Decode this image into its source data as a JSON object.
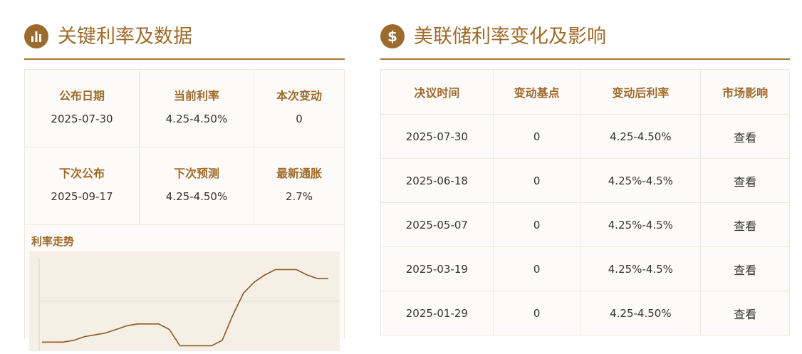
{
  "left": {
    "title": "关键利率及数据",
    "icon": "bar-chart-icon",
    "stats": [
      {
        "label": "公布日期",
        "value": "2025-07-30"
      },
      {
        "label": "当前利率",
        "value": "4.25-4.50%"
      },
      {
        "label": "本次变动",
        "value": "0"
      },
      {
        "label": "下次公布",
        "value": "2025-09-17"
      },
      {
        "label": "下次预测",
        "value": "4.25-4.50%"
      },
      {
        "label": "最新通胀",
        "value": "2.7%"
      }
    ],
    "trend_title": "利率走势"
  },
  "right": {
    "title": "美联储利率变化及影响",
    "icon": "dollar-icon",
    "columns": [
      "决议时间",
      "变动基点",
      "变动后利率",
      "市场影响"
    ],
    "rows": [
      {
        "date": "2025-07-30",
        "bp": "0",
        "rate": "4.25-4.50%",
        "impact": "查看"
      },
      {
        "date": "2025-06-18",
        "bp": "0",
        "rate": "4.25%-4.5%",
        "impact": "查看"
      },
      {
        "date": "2025-05-07",
        "bp": "0",
        "rate": "4.25%-4.5%",
        "impact": "查看"
      },
      {
        "date": "2025-03-19",
        "bp": "0",
        "rate": "4.25%-4.5%",
        "impact": "查看"
      },
      {
        "date": "2025-01-29",
        "bp": "0",
        "rate": "4.25-4.50%",
        "impact": "查看"
      }
    ]
  },
  "colors": {
    "accent": "#a06a2a",
    "line": "#8a5a1e"
  },
  "chart_data": {
    "type": "line",
    "title": "利率走势",
    "series": [
      {
        "values": [
          0.5,
          0.5,
          0.5,
          0.6,
          0.8,
          0.9,
          1.0,
          1.2,
          1.4,
          1.5,
          1.5,
          1.5,
          1.2,
          0.3,
          0.3,
          0.3,
          0.3,
          0.6,
          2.0,
          3.2,
          3.8,
          4.2,
          4.5,
          4.5,
          4.5,
          4.2,
          4.0,
          4.0
        ]
      }
    ],
    "ylim": [
      0,
      5.5
    ]
  }
}
